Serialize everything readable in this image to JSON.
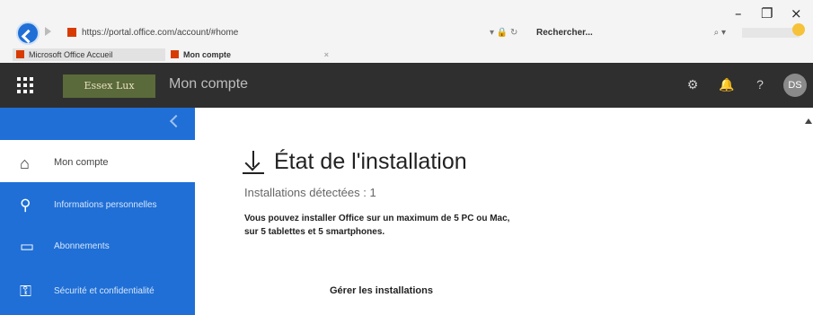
{
  "window": {
    "minimize": "–",
    "restore": "❐",
    "close": "×"
  },
  "browser": {
    "url": "https://portal.office.com/account/#home",
    "address_icons": "▾ 🔒 ↻",
    "search_placeholder": "Rechercher...",
    "search_icon": "⌕ ▾",
    "tabs": [
      {
        "label": "Microsoft Office Accueil"
      },
      {
        "label": "Mon compte"
      }
    ],
    "tab_close": "×"
  },
  "app": {
    "logo_text": "Essex Lux",
    "title": "Mon compte",
    "header_icons": [
      "⚙",
      "🔔",
      "?"
    ],
    "avatar_initials": "DS"
  },
  "sidebar": {
    "home_label": "Mon compte",
    "items": [
      {
        "label": "Informations personnelles",
        "icon": "person-icon"
      },
      {
        "label": "Abonnements",
        "icon": "card-icon"
      },
      {
        "label": "Sécurité et confidentialité",
        "icon": "security-icon"
      }
    ]
  },
  "main": {
    "title": "État de l'installation",
    "subtitle": "Installations détectées : 1",
    "description": "Vous pouvez installer Office sur un maximum de 5 PC ou Mac, sur 5 tablettes et 5 smartphones.",
    "manage_link": "Gérer les installations"
  },
  "colors": {
    "accent": "#1f6fd6",
    "appbar": "#2f2f2f"
  }
}
